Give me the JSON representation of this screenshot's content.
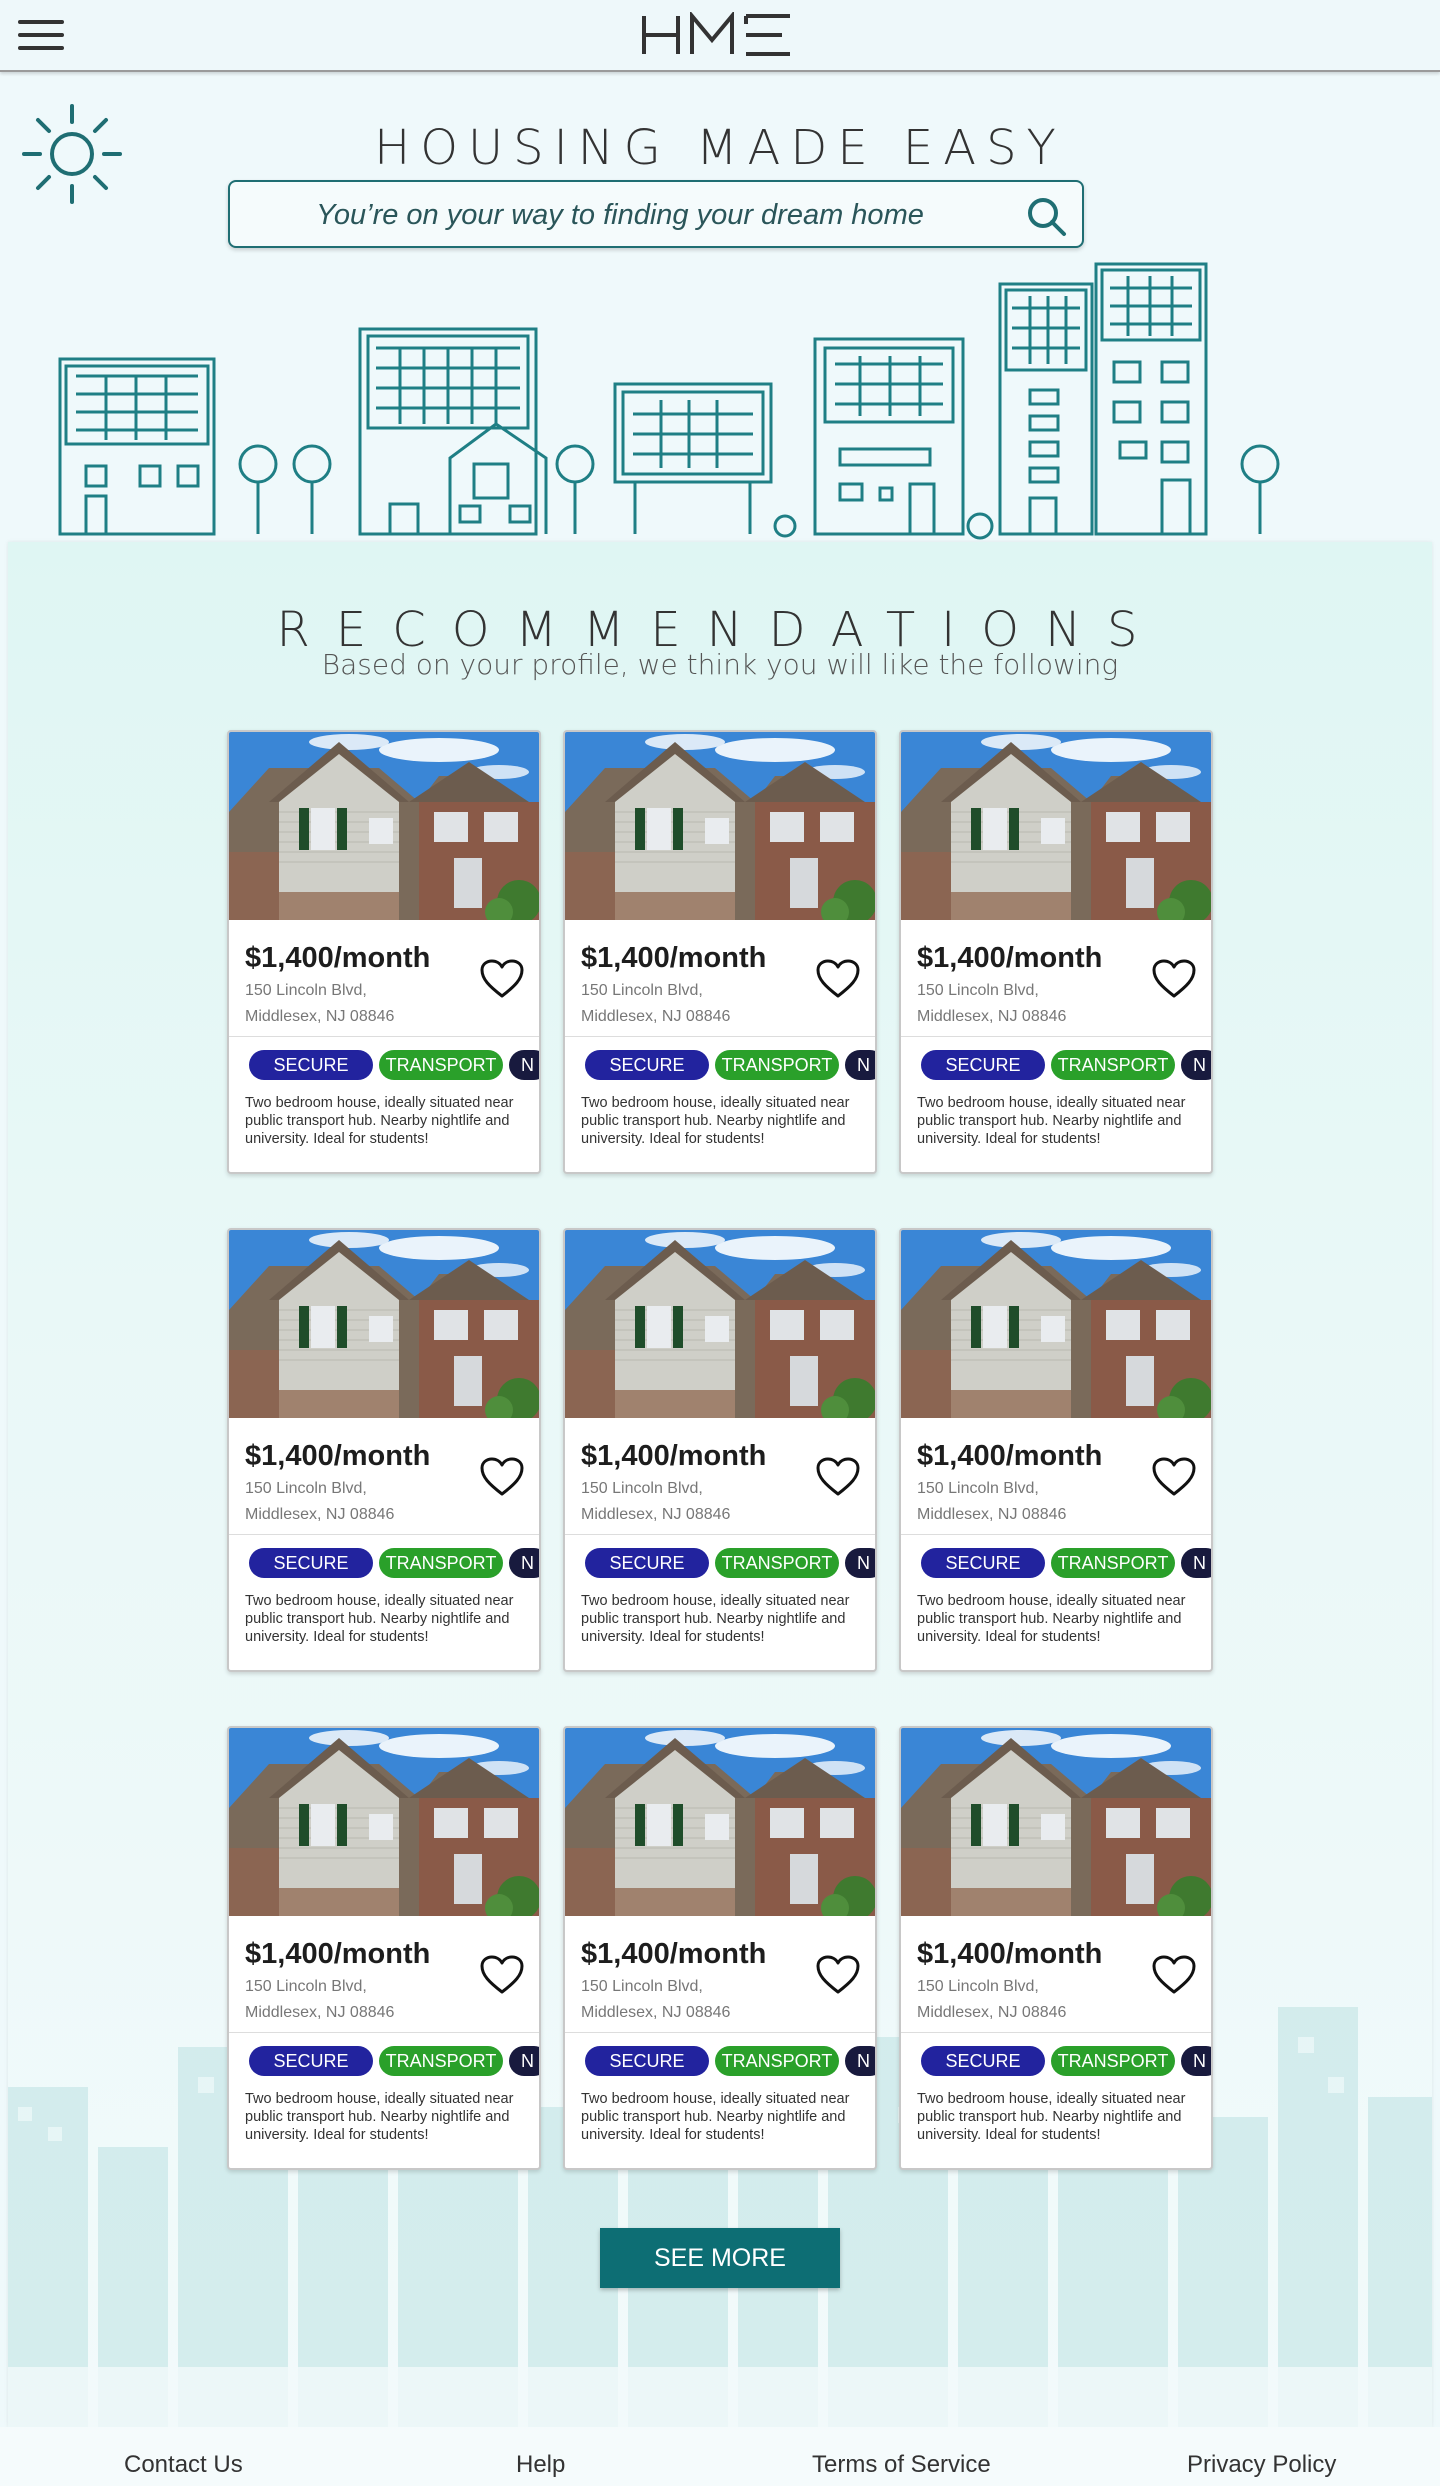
{
  "header": {
    "menu_icon": "hamburger-menu-icon",
    "logo_text": "HME"
  },
  "hero": {
    "title": "HOUSING MADE EASY",
    "search_placeholder": "You’re on your way to finding your dream home",
    "search_icon": "search-icon",
    "sun_icon": "sun-icon"
  },
  "recommendations": {
    "title": "RECOMMENDATIONS",
    "subtitle": "Based on your profile, we think you will like the following",
    "listings": [
      {
        "price": "$1,400/month",
        "address_line1": "150 Lincoln Blvd,",
        "address_line2": "Middlesex, NJ 08846",
        "tags": [
          "SECURE",
          "TRANSPORT",
          "N"
        ],
        "description": "Two bedroom house, ideally situated near public transport hub. Nearby nightlife and university. Ideal for students!"
      },
      {
        "price": "$1,400/month",
        "address_line1": "150 Lincoln Blvd,",
        "address_line2": "Middlesex, NJ 08846",
        "tags": [
          "SECURE",
          "TRANSPORT",
          "N"
        ],
        "description": "Two bedroom house, ideally situated near public transport hub. Nearby nightlife and university. Ideal for students!"
      },
      {
        "price": "$1,400/month",
        "address_line1": "150 Lincoln Blvd,",
        "address_line2": "Middlesex, NJ 08846",
        "tags": [
          "SECURE",
          "TRANSPORT",
          "N"
        ],
        "description": "Two bedroom house, ideally situated near public transport hub. Nearby nightlife and university. Ideal for students!"
      },
      {
        "price": "$1,400/month",
        "address_line1": "150 Lincoln Blvd,",
        "address_line2": "Middlesex, NJ 08846",
        "tags": [
          "SECURE",
          "TRANSPORT",
          "N"
        ],
        "description": "Two bedroom house, ideally situated near public transport hub. Nearby nightlife and university. Ideal for students!"
      },
      {
        "price": "$1,400/month",
        "address_line1": "150 Lincoln Blvd,",
        "address_line2": "Middlesex, NJ 08846",
        "tags": [
          "SECURE",
          "TRANSPORT",
          "N"
        ],
        "description": "Two bedroom house, ideally situated near public transport hub. Nearby nightlife and university. Ideal for students!"
      },
      {
        "price": "$1,400/month",
        "address_line1": "150 Lincoln Blvd,",
        "address_line2": "Middlesex, NJ 08846",
        "tags": [
          "SECURE",
          "TRANSPORT",
          "N"
        ],
        "description": "Two bedroom house, ideally situated near public transport hub. Nearby nightlife and university. Ideal for students!"
      },
      {
        "price": "$1,400/month",
        "address_line1": "150 Lincoln Blvd,",
        "address_line2": "Middlesex, NJ 08846",
        "tags": [
          "SECURE",
          "TRANSPORT",
          "N"
        ],
        "description": "Two bedroom house, ideally situated near public transport hub. Nearby nightlife and university. Ideal for students!"
      },
      {
        "price": "$1,400/month",
        "address_line1": "150 Lincoln Blvd,",
        "address_line2": "Middlesex, NJ 08846",
        "tags": [
          "SECURE",
          "TRANSPORT",
          "N"
        ],
        "description": "Two bedroom house, ideally situated near public transport hub. Nearby nightlife and university. Ideal for students!"
      },
      {
        "price": "$1,400/month",
        "address_line1": "150 Lincoln Blvd,",
        "address_line2": "Middlesex, NJ 08846",
        "tags": [
          "SECURE",
          "TRANSPORT",
          "N"
        ],
        "description": "Two bedroom house, ideally situated near public transport hub. Nearby nightlife and university. Ideal for students!"
      }
    ],
    "see_more_label": "SEE MORE"
  },
  "footer": {
    "links": [
      "Contact Us",
      "Help",
      "Terms of Service",
      "Privacy Policy"
    ]
  },
  "colors": {
    "accent": "#0d6e74",
    "secure_tag": "#22239e",
    "transport_tag": "#2aa02a",
    "nightlife_tag": "#181a3e",
    "background": "#eff9fb"
  }
}
